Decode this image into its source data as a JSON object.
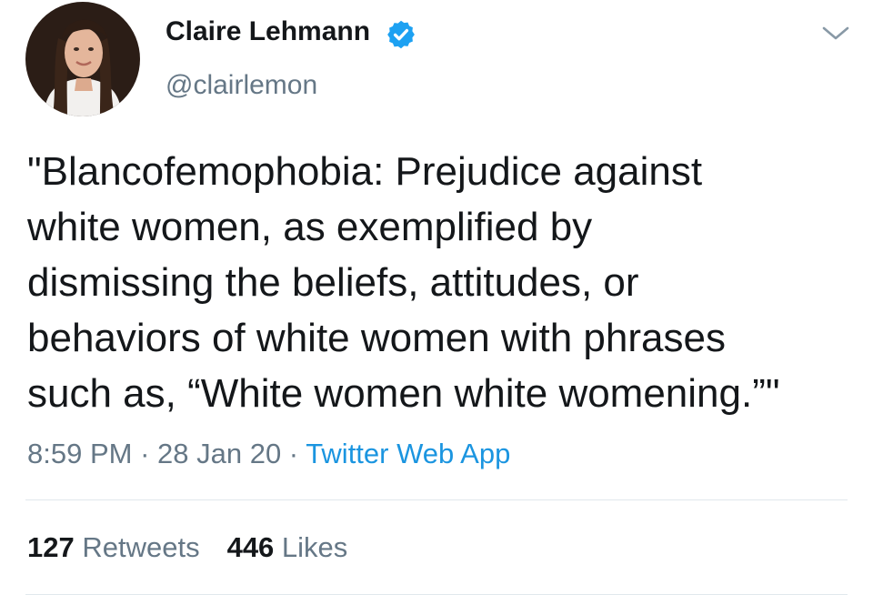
{
  "author": {
    "display_name": "Claire Lehmann",
    "handle": "@clairlemon",
    "verified_icon": "verified-badge-icon"
  },
  "tweet": {
    "lines": [
      "\"Blancofemophobia: Prejudice against",
      "white women, as exemplified by",
      "dismissing the beliefs, attitudes, or",
      "behaviors of white women with phrases",
      "such as, “White women white womening.”\""
    ]
  },
  "meta": {
    "time": "8:59 PM",
    "separator": " · ",
    "date": "28 Jan 20",
    "source": "Twitter Web App"
  },
  "stats": {
    "retweets_count": "127",
    "retweets_label": " Retweets",
    "likes_count": "446",
    "likes_label": " Likes"
  },
  "colors": {
    "text": "#14171a",
    "secondary": "#657786",
    "link": "#1b95e0",
    "verified": "#1da1f2",
    "divider": "#e1e8ed"
  }
}
